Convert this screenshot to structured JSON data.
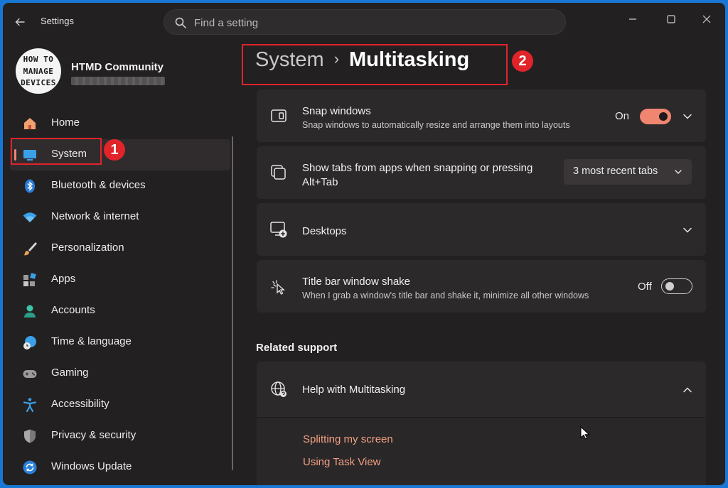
{
  "window": {
    "app_title": "Settings",
    "search": {
      "placeholder": "Find a setting"
    },
    "controls": [
      "minimize",
      "maximize",
      "close"
    ]
  },
  "profile": {
    "name": "HTMD Community",
    "avatar_text": [
      "HOW TO",
      "MANAGE",
      "DEVICES"
    ]
  },
  "sidebar": {
    "items": [
      {
        "label": "Home",
        "icon": "home-icon",
        "active": false
      },
      {
        "label": "System",
        "icon": "monitor-icon",
        "active": true
      },
      {
        "label": "Bluetooth & devices",
        "icon": "bluetooth-icon",
        "active": false
      },
      {
        "label": "Network & internet",
        "icon": "wifi-icon",
        "active": false
      },
      {
        "label": "Personalization",
        "icon": "brush-icon",
        "active": false
      },
      {
        "label": "Apps",
        "icon": "apps-icon",
        "active": false
      },
      {
        "label": "Accounts",
        "icon": "person-icon",
        "active": false
      },
      {
        "label": "Time & language",
        "icon": "globe-clock-icon",
        "active": false
      },
      {
        "label": "Gaming",
        "icon": "gamepad-icon",
        "active": false
      },
      {
        "label": "Accessibility",
        "icon": "accessibility-icon",
        "active": false
      },
      {
        "label": "Privacy & security",
        "icon": "shield-icon",
        "active": false
      },
      {
        "label": "Windows Update",
        "icon": "update-icon",
        "active": false
      }
    ]
  },
  "breadcrumb": {
    "parent": "System",
    "current": "Multitasking",
    "separator": "›"
  },
  "annotations": {
    "badge1": "1",
    "badge2": "2",
    "color": "#e0242a"
  },
  "settings": {
    "snap": {
      "title": "Snap windows",
      "subtitle": "Snap windows to automatically resize and arrange them into layouts",
      "state": "On",
      "enabled": true
    },
    "tabs": {
      "title": "Show tabs from apps when snapping or pressing",
      "title_line2": "Alt+Tab",
      "value": "3 most recent tabs"
    },
    "desktops": {
      "title": "Desktops"
    },
    "shake": {
      "title": "Title bar window shake",
      "subtitle": "When I grab a window's title bar and shake it, minimize all other windows",
      "state": "Off",
      "enabled": false
    }
  },
  "related": {
    "heading": "Related support",
    "help_title": "Help with Multitasking",
    "links": [
      "Splitting my screen",
      "Using Task View"
    ]
  },
  "colors": {
    "accent": "#f08570",
    "link": "#f0a080",
    "background": "#232022",
    "card": "#2c292b"
  }
}
